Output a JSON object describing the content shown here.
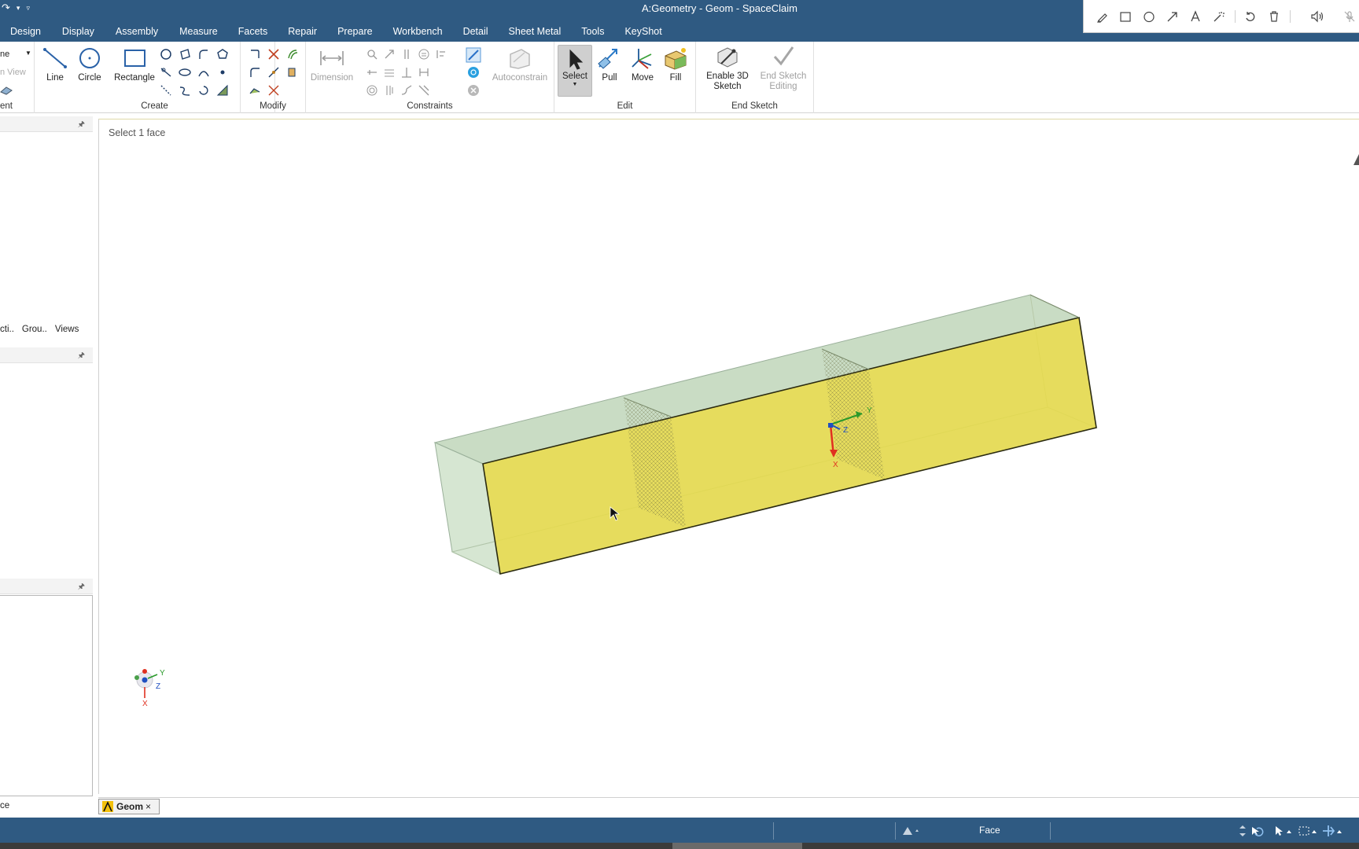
{
  "app": {
    "window_title": "A:Geometry - Geom - SpaceClaim"
  },
  "menu": {
    "items": [
      "Design",
      "Display",
      "Assembly",
      "Measure",
      "Facets",
      "Repair",
      "Prepare",
      "Workbench",
      "Detail",
      "Sheet Metal",
      "Tools",
      "KeyShot"
    ]
  },
  "ribbon": {
    "partial_group_label": "ent",
    "partial_dropdown": "ne",
    "partial_view": "n View",
    "create": {
      "label": "Create",
      "line": "Line",
      "circle": "Circle",
      "rectangle": "Rectangle"
    },
    "modify": {
      "label": "Modify"
    },
    "constraints": {
      "label": "Constraints",
      "dimension": "Dimension",
      "autoconstrain": "Autoconstrain"
    },
    "edit": {
      "label": "Edit",
      "select": "Select",
      "pull": "Pull",
      "move": "Move",
      "fill": "Fill"
    },
    "end_sketch": {
      "label": "End Sketch",
      "enable_3d_line1": "Enable 3D",
      "enable_3d_line2": "Sketch",
      "end_editing_line1": "End Sketch",
      "end_editing_line2": "Editing"
    }
  },
  "left_panel": {
    "tabs": [
      "cti..",
      "Grou..",
      "Views"
    ],
    "bottom_label": "ce"
  },
  "viewport": {
    "prompt": "Select 1 face",
    "triad_labels": {
      "x": "X",
      "y": "Y",
      "z": "Z"
    }
  },
  "doc_tabs": {
    "active": "Geom",
    "close": "×"
  },
  "status": {
    "selection_filter": "Face"
  },
  "colors": {
    "chrome_blue": "#2f5a82",
    "face_yellow": "#e4d94f",
    "body_green": "#c9dcc4",
    "axis_x": "#e03020",
    "axis_y": "#2a9a2a",
    "axis_z": "#2050c0"
  }
}
